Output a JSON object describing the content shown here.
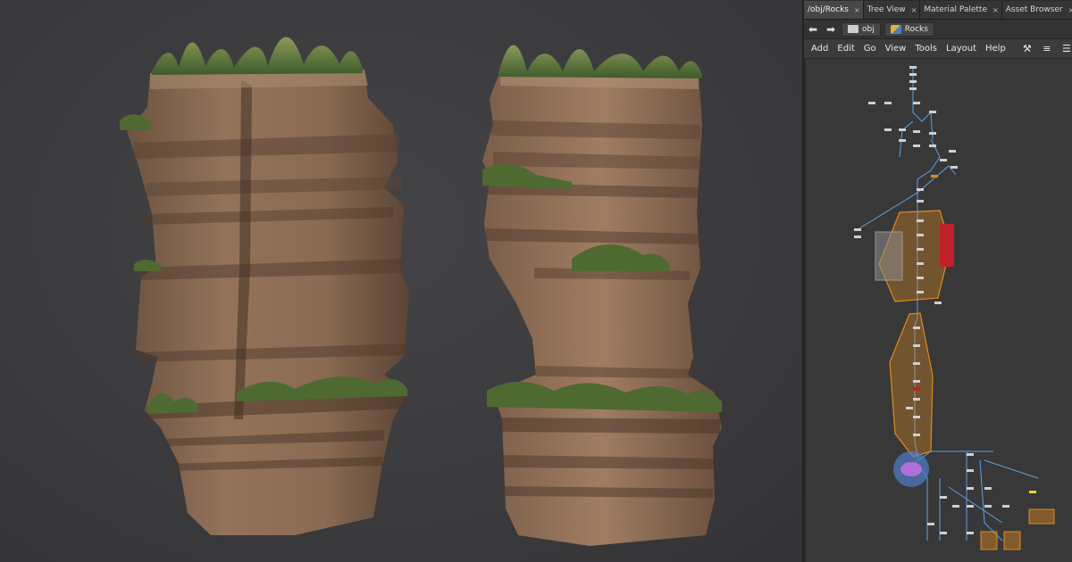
{
  "tabs": [
    {
      "label": "/obj/Rocks",
      "close": "×",
      "active": true
    },
    {
      "label": "Tree View",
      "close": "×",
      "active": false
    },
    {
      "label": "Material Palette",
      "close": "×",
      "active": false
    },
    {
      "label": "Asset Browser",
      "close": "×",
      "active": false
    }
  ],
  "tab_add": "+",
  "path": {
    "back": "back-arrow-icon",
    "forward": "forward-arrow-icon",
    "root": "obj",
    "current": "Rocks"
  },
  "menu": [
    "Add",
    "Edit",
    "Go",
    "View",
    "Tools",
    "Layout",
    "Help"
  ],
  "tools": [
    "wrench-icon",
    "tree-icon",
    "list-icon"
  ],
  "colors": {
    "network_bg": "#383838",
    "node": "#cfcfcf",
    "wire": "#5aa0e6",
    "group": "#e08a1e",
    "red_node": "#c0202a",
    "purple_node": "#b070d8"
  }
}
